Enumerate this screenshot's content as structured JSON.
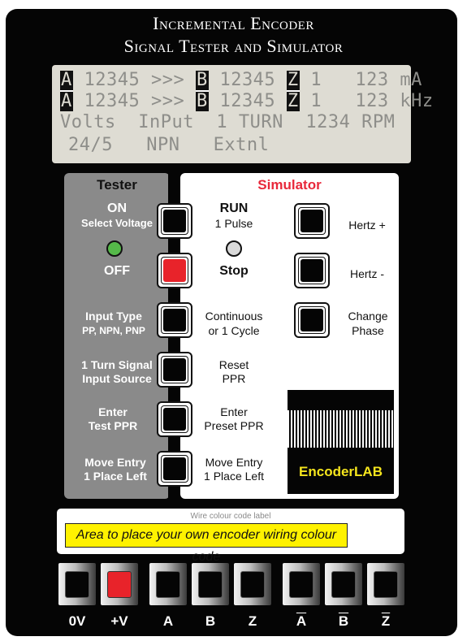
{
  "header": {
    "title_line1": "Incremental Encoder",
    "title_line2": "Signal Tester and Simulator"
  },
  "lcd": {
    "row1": {
      "ch_a": "A",
      "val_a": " 12345 >>> ",
      "ch_b": "B",
      "val_b": " 12345 ",
      "ch_z": "Z",
      "rest": " 1   123 mA"
    },
    "row2": {
      "ch_a": "A",
      "val_a": " 12345 >>> ",
      "ch_b": "B",
      "val_b": " 12345 ",
      "ch_z": "Z",
      "rest": " 1   123 kHz"
    },
    "row3": "Volts  InPut  1 TURN  1234 RPM",
    "row4": "24/5   NPN   Extnl"
  },
  "tester": {
    "title": "Tester",
    "on_label": "ON",
    "select_voltage": "Select Voltage",
    "off_label": "OFF",
    "input_type": "Input Type",
    "input_type_sub": "PP, NPN, PNP",
    "turn_signal_1": "1 Turn Signal",
    "turn_signal_2": "Input Source",
    "enter_test_1": "Enter",
    "enter_test_2": "Test PPR",
    "move_entry_1": "Move Entry",
    "move_entry_2": "1 Place Left",
    "led_color": "#55b949"
  },
  "simulator": {
    "title": "Simulator",
    "run_label": "RUN",
    "one_pulse": "1 Pulse",
    "stop_label": "Stop",
    "continuous_1": "Continuous",
    "continuous_2": "or 1 Cycle",
    "reset_1": "Reset",
    "reset_2": "PPR",
    "enter_preset_1": "Enter",
    "enter_preset_2": "Preset PPR",
    "move_entry_1": "Move Entry",
    "move_entry_2": "1 Place Left",
    "hertz_plus": "Hertz +",
    "hertz_minus": "Hertz -",
    "change_phase_1": "Change",
    "change_phase_2": "Phase",
    "title_color": "#e8283a"
  },
  "logo": {
    "text": "EncoderLAB",
    "color": "#f5e51d"
  },
  "wire_label": {
    "caption": "Wire colour code label",
    "placeholder": "Area to place your own encoder wiring colour code"
  },
  "terminals": [
    {
      "label": "0V"
    },
    {
      "label": "+V"
    },
    {
      "label": "A"
    },
    {
      "label": "B"
    },
    {
      "label": "Z"
    },
    {
      "label": "A",
      "inverted": true
    },
    {
      "label": "B",
      "inverted": true
    },
    {
      "label": "Z",
      "inverted": true
    }
  ]
}
